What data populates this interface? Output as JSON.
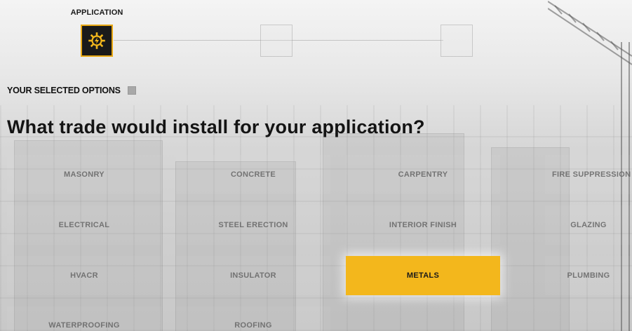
{
  "stepper": {
    "steps": [
      {
        "label": "APPLICATION",
        "state": "active",
        "icon": "gear-lightning-icon"
      },
      {
        "label": "",
        "state": "inactive"
      },
      {
        "label": "",
        "state": "inactive"
      }
    ]
  },
  "selected_options": {
    "label": "YOUR SELECTED OPTIONS",
    "toggle_icon": "expand-toggle-icon"
  },
  "question": "What trade would install for your application?",
  "trades": [
    {
      "label": "MASONRY",
      "selected": false
    },
    {
      "label": "CONCRETE",
      "selected": false
    },
    {
      "label": "CARPENTRY",
      "selected": false
    },
    {
      "label": "FIRE SUPPRESSION",
      "selected": false
    },
    {
      "label": "ELECTRICAL",
      "selected": false
    },
    {
      "label": "STEEL ERECTION",
      "selected": false
    },
    {
      "label": "INTERIOR FINISH",
      "selected": false
    },
    {
      "label": "GLAZING",
      "selected": false
    },
    {
      "label": "HVACR",
      "selected": false
    },
    {
      "label": "INSULATOR",
      "selected": false
    },
    {
      "label": "METALS",
      "selected": true
    },
    {
      "label": "PLUMBING",
      "selected": false
    },
    {
      "label": "WATERPROOFING",
      "selected": false
    },
    {
      "label": "ROOFING",
      "selected": false
    }
  ],
  "colors": {
    "accent": "#f3b71c",
    "active_step_border": "#e8a814",
    "active_step_bg": "#1a1a1a"
  }
}
